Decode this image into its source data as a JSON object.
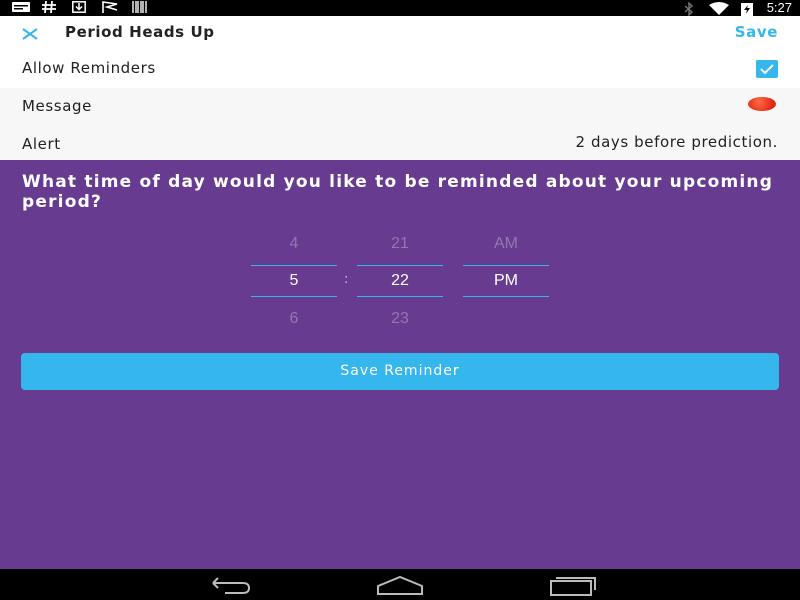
{
  "status_bar": {
    "time": "5:27",
    "left_icons": [
      "notification-icon",
      "hash-icon",
      "download-icon",
      "flag-icon",
      "barcode-icon"
    ],
    "right_icons": [
      "bluetooth-icon",
      "wifi-icon",
      "battery-charging-icon"
    ]
  },
  "header": {
    "title": "Period Heads Up",
    "save_label": "Save"
  },
  "settings": {
    "allow_reminders_label": "Allow Reminders",
    "allow_reminders_checked": true,
    "message_label": "Message",
    "alert_label": "Alert",
    "alert_value": "2 days before prediction."
  },
  "main": {
    "question": "What time of day would you like to be reminded about your upcoming period?",
    "picker": {
      "hour": {
        "prev": "4",
        "selected": "5",
        "next": "6"
      },
      "minute": {
        "prev": "21",
        "selected": "22",
        "next": "23"
      },
      "ampm": {
        "prev": "AM",
        "selected": "PM",
        "next": ""
      },
      "separator": ":"
    },
    "save_button": "Save Reminder"
  },
  "nav_bar": {
    "buttons": [
      "back-icon",
      "home-icon",
      "recents-icon"
    ]
  },
  "colors": {
    "accent": "#35b6ec",
    "background": "#673b8f",
    "message_dot": "#e02a10"
  }
}
